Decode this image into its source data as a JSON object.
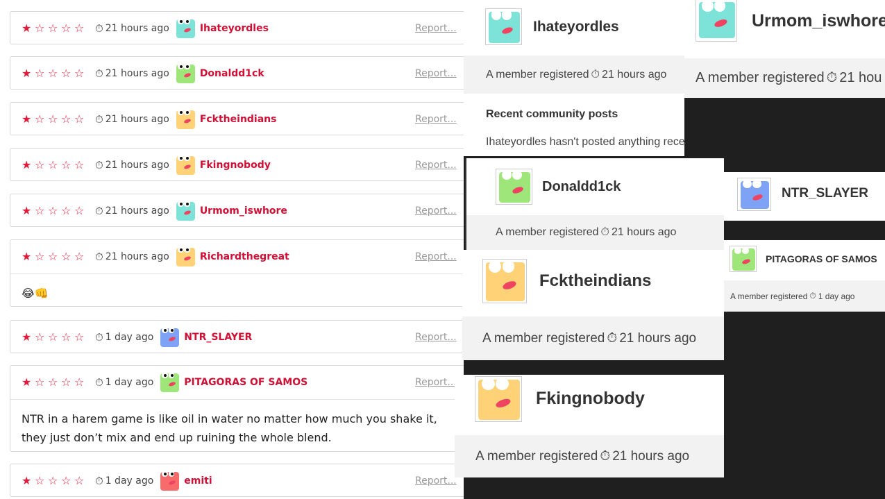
{
  "reviews": [
    {
      "stars": 1,
      "time": "21 hours ago",
      "user": "Ihateyordles",
      "avatar_color": "#7de3d8",
      "report": "Report...",
      "text": ""
    },
    {
      "stars": 1,
      "time": "21 hours ago",
      "user": "Donaldd1ck",
      "avatar_color": "#9ee67a",
      "report": "Report...",
      "text": ""
    },
    {
      "stars": 1,
      "time": "21 hours ago",
      "user": "Fcktheindians",
      "avatar_color": "#ffd277",
      "report": "Report...",
      "text": ""
    },
    {
      "stars": 1,
      "time": "21 hours ago",
      "user": "Fkingnobody",
      "avatar_color": "#ffd277",
      "report": "Report...",
      "text": ""
    },
    {
      "stars": 1,
      "time": "21 hours ago",
      "user": "Urmom_iswhore",
      "avatar_color": "#7de3d8",
      "report": "Report...",
      "text": ""
    },
    {
      "stars": 1,
      "time": "21 hours ago",
      "user": "Richardthegreat",
      "avatar_color": "#ffd277",
      "report": "Report...",
      "text": "😂👊"
    },
    {
      "stars": 1,
      "time": "1 day ago",
      "user": "NTR_SLAYER",
      "avatar_color": "#7ea2f5",
      "report": "Report...",
      "text": ""
    },
    {
      "stars": 1,
      "time": "1 day ago",
      "user": "PITAGORAS OF SAMOS",
      "avatar_color": "#9ee67a",
      "report": "Report...",
      "text": "NTR in a harem game is like oil in water no matter how much you shake it, they just don’t mix and end up ruining the whole blend."
    },
    {
      "stars": 1,
      "time": "1 day ago",
      "user": "emiti",
      "avatar_color": "#f76b6b",
      "report": "Report...",
      "text": ""
    }
  ],
  "profiles": [
    {
      "name": "Ihateyordles",
      "footer_prefix": "A member registered",
      "footer_time": "21 hours ago",
      "avatar_color": "#7de3d8"
    },
    {
      "name": "Urmom_iswhore",
      "footer_prefix": "A member registered",
      "footer_time": "21 hou",
      "avatar_color": "#7de3d8"
    },
    {
      "name": "Donaldd1ck",
      "footer_prefix": "A member registered",
      "footer_time": "21 hours ago",
      "avatar_color": "#9ee67a"
    },
    {
      "name": "NTR_SLAYER",
      "footer_prefix": "",
      "footer_time": "",
      "avatar_color": "#7ea2f5"
    },
    {
      "name": "PITAGORAS OF SAMOS",
      "footer_prefix": "A member registered",
      "footer_time": "1 day ago",
      "avatar_color": "#9ee67a"
    },
    {
      "name": "Fcktheindians",
      "footer_prefix": "A member registered",
      "footer_time": "21 hours ago",
      "avatar_color": "#ffd277"
    },
    {
      "name": "Fkingnobody",
      "footer_prefix": "A member registered",
      "footer_time": "21 hours ago",
      "avatar_color": "#ffd277"
    }
  ],
  "community": {
    "heading": "Recent community posts",
    "empty_text": "Ihateyordles hasn't posted anything recently"
  },
  "icons": {
    "star_filled": "★",
    "star_empty": "☆",
    "clock": "⏱"
  },
  "colors": {
    "accent": "#d01035",
    "star": "#e21b3a",
    "dark_bg": "#1f1f1f"
  }
}
